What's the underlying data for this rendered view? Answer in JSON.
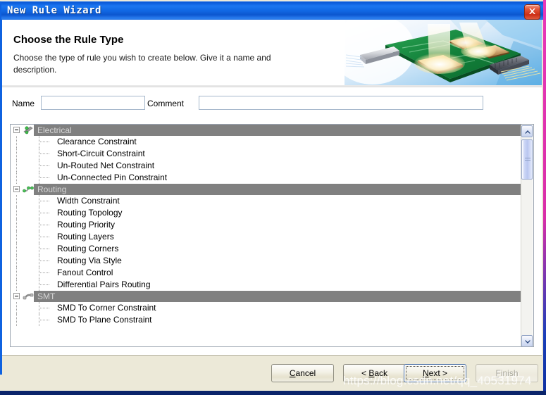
{
  "window": {
    "title": "New Rule Wizard",
    "close_icon": "close-icon"
  },
  "header": {
    "title": "Choose the Rule Type",
    "description": "Choose the type of rule you wish to create below. Give it a name and description.",
    "artwork": "pcb-board-illustration"
  },
  "fields": {
    "name_label": "Name",
    "name_value": "",
    "name_placeholder": "",
    "comment_label": "Comment",
    "comment_value": "",
    "comment_placeholder": ""
  },
  "tree": {
    "groups": [
      {
        "label": "Electrical",
        "icon": "electrical-icon",
        "expanded": true,
        "items": [
          "Clearance Constraint",
          "Short-Circuit Constraint",
          "Un-Routed Net Constraint",
          "Un-Connected Pin Constraint"
        ]
      },
      {
        "label": "Routing",
        "icon": "routing-icon",
        "expanded": true,
        "items": [
          "Width Constraint",
          "Routing Topology",
          "Routing Priority",
          "Routing Layers",
          "Routing Corners",
          "Routing Via Style",
          "Fanout Control",
          "Differential Pairs Routing"
        ]
      },
      {
        "label": "SMT",
        "icon": "smt-icon",
        "expanded": true,
        "items": [
          "SMD To Corner Constraint",
          "SMD To Plane Constraint"
        ]
      }
    ]
  },
  "scrollbar": {
    "up_icon": "chevron-up-icon",
    "down_icon": "chevron-down-icon"
  },
  "footer": {
    "cancel": {
      "prefix": "",
      "accel": "C",
      "suffix": "ancel",
      "enabled": true
    },
    "back": {
      "prefix": "< ",
      "accel": "B",
      "suffix": "ack",
      "enabled": true
    },
    "next": {
      "prefix": "",
      "accel": "N",
      "suffix": "ext >",
      "enabled": true
    },
    "finish": {
      "prefix": "",
      "accel": "F",
      "suffix": "inish",
      "enabled": false
    }
  },
  "watermark": "https://blog.csdn.net/qq_40531974",
  "colors": {
    "titlebar_blue": "#1168e4",
    "close_red": "#cc2f16",
    "group_bar_gray": "#808080",
    "dialog_beige": "#ece9d8",
    "pcb_green": "#1f8a3c"
  }
}
